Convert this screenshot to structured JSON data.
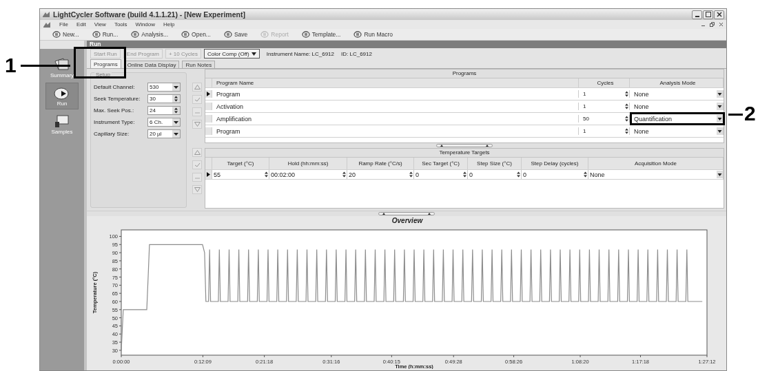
{
  "window": {
    "title": "LightCycler Software (build 4.1.1.21) - [New Experiment]"
  },
  "menu": [
    "File",
    "Edit",
    "View",
    "Tools",
    "Window",
    "Help"
  ],
  "toolbar": [
    {
      "label": "New...",
      "disabled": false
    },
    {
      "label": "Run...",
      "disabled": false
    },
    {
      "label": "Analysis...",
      "disabled": false
    },
    {
      "label": "Open...",
      "disabled": false
    },
    {
      "label": "Save",
      "disabled": false
    },
    {
      "label": "Report",
      "disabled": true
    },
    {
      "label": "Template...",
      "disabled": false
    },
    {
      "label": "Run Macro",
      "disabled": false
    }
  ],
  "sidebar": {
    "items": [
      {
        "label": "Summary",
        "selected": false
      },
      {
        "label": "Run",
        "selected": true
      },
      {
        "label": "Samples",
        "selected": false
      }
    ]
  },
  "run_panel": {
    "title": "Run",
    "buttons": [
      {
        "label": "Start Run",
        "disabled": true
      },
      {
        "label": "End Program",
        "disabled": true
      },
      {
        "label": "+ 10 Cycles",
        "disabled": true
      }
    ],
    "color_comp": "Color Comp (Off)",
    "instrument_name": "Instrument Name: LC_6912",
    "instrument_id": "ID: LC_6912"
  },
  "tabs": [
    {
      "label": "Programs",
      "selected": true
    },
    {
      "label": "Online Data Display",
      "selected": false
    },
    {
      "label": "Run Notes",
      "selected": false
    }
  ],
  "setup": {
    "title": "Setup",
    "fields": [
      {
        "label": "Default Channel:",
        "value": "530",
        "kind": "dropdown"
      },
      {
        "label": "Seek Temperature:",
        "value": "30",
        "kind": "spinner"
      },
      {
        "label": "Max. Seek Pos.:",
        "value": "24",
        "kind": "spinner"
      },
      {
        "label": "Instrument Type:",
        "value": "6 Ch.",
        "kind": "dropdown"
      },
      {
        "label": "Capillary Size:",
        "value": "20 µl",
        "kind": "dropdown"
      }
    ]
  },
  "programs": {
    "title": "Programs",
    "columns": [
      "Program Name",
      "Cycles",
      "Analysis Mode"
    ],
    "rows": [
      {
        "name": "Program",
        "cycles": "1",
        "analysis_mode": "None",
        "selected": true
      },
      {
        "name": "Activation",
        "cycles": "1",
        "analysis_mode": "None",
        "selected": false
      },
      {
        "name": "Amplification",
        "cycles": "50",
        "analysis_mode": "Quantification",
        "selected": false
      },
      {
        "name": "Program",
        "cycles": "1",
        "analysis_mode": "None",
        "selected": false
      }
    ]
  },
  "temperature_targets": {
    "title": "Temperature Targets",
    "columns": [
      "Target (°C)",
      "Hold (hh:mm:ss)",
      "Ramp Rate (°C/s)",
      "Sec Target (°C)",
      "Step Size (°C)",
      "Step Delay (cycles)",
      "Acquisition Mode"
    ],
    "rows": [
      {
        "cells": [
          "55",
          "00:02:00",
          "20",
          "0",
          "0",
          "0",
          "None"
        ],
        "selected": true
      }
    ]
  },
  "overview": {
    "chart_data": {
      "type": "line",
      "title": "Overview",
      "xlabel": "Time (h:mm:ss)",
      "ylabel": "Temperature (°C)",
      "xlim": [
        0,
        87.2
      ],
      "ylim": [
        27,
        104
      ],
      "yticks": [
        30,
        35,
        40,
        45,
        50,
        55,
        60,
        65,
        70,
        75,
        80,
        85,
        90,
        95,
        100
      ],
      "xticks": [
        {
          "value": 0,
          "label": "0:00:00"
        },
        {
          "value": 12.15,
          "label": "0:12:09"
        },
        {
          "value": 21.3,
          "label": "0:21:18"
        },
        {
          "value": 31.27,
          "label": "0:31:16"
        },
        {
          "value": 40.25,
          "label": "0:40:15"
        },
        {
          "value": 49.47,
          "label": "0:49:28"
        },
        {
          "value": 58.43,
          "label": "0:58:26"
        },
        {
          "value": 68.33,
          "label": "1:08:20"
        },
        {
          "value": 77.3,
          "label": "1:17:18"
        },
        {
          "value": 87.2,
          "label": "1:27:12"
        }
      ],
      "x": [
        0,
        0.3,
        3.8,
        4.0,
        4.2,
        12.1,
        12.4,
        12.6,
        13,
        13.15,
        13.3,
        14.45,
        14.6,
        14.75,
        15.9,
        16.05,
        16.2,
        17.35,
        17.5,
        17.65,
        18.8,
        18.95,
        19.1,
        20.25,
        20.4,
        20.55,
        21.7,
        21.85,
        22,
        23.15,
        23.3,
        23.45,
        24.6,
        24.75,
        24.9,
        26.05,
        26.2,
        26.35,
        27.5,
        27.65,
        27.8,
        28.95,
        29.1,
        29.25,
        30.4,
        30.55,
        30.7,
        31.85,
        32,
        32.15,
        33.3,
        33.45,
        33.6,
        34.75,
        34.9,
        35.05,
        36.2,
        36.35,
        36.5,
        37.65,
        37.8,
        37.95,
        39.1,
        39.25,
        39.4,
        40.55,
        40.7,
        40.85,
        42,
        42.15,
        42.3,
        43.45,
        43.6,
        43.75,
        44.9,
        45.05,
        45.2,
        46.35,
        46.5,
        46.65,
        47.8,
        47.95,
        48.1,
        49.25,
        49.4,
        49.55,
        50.7,
        50.85,
        51,
        52.15,
        52.3,
        52.45,
        53.6,
        53.75,
        53.9,
        55.05,
        55.2,
        55.35,
        56.5,
        56.65,
        56.8,
        57.95,
        58.1,
        58.25,
        59.4,
        59.55,
        59.7,
        60.85,
        61,
        61.15,
        62.3,
        62.45,
        62.6,
        63.75,
        63.9,
        64.05,
        65.2,
        65.35,
        65.5,
        66.65,
        66.8,
        66.95,
        68.1,
        68.25,
        68.4,
        69.55,
        69.7,
        69.85,
        71,
        71.15,
        71.3,
        72.45,
        72.6,
        72.75,
        73.9,
        74.05,
        74.2,
        75.35,
        75.5,
        75.65,
        76.8,
        76.95,
        77.1,
        78.25,
        78.4,
        78.55,
        79.7,
        79.85,
        80,
        81.15,
        81.3,
        81.45,
        82.6,
        82.75,
        82.9,
        84.05,
        84.2,
        84.35,
        86.5
      ],
      "series": [
        {
          "color": "#8c8c8c",
          "values": [
            30,
            55,
            55,
            75,
            95,
            95,
            90,
            60,
            60,
            92,
            60,
            60,
            92,
            60,
            60,
            92,
            60,
            60,
            92,
            60,
            60,
            92,
            60,
            60,
            92,
            60,
            60,
            92,
            60,
            60,
            92,
            60,
            60,
            92,
            60,
            60,
            92,
            60,
            60,
            92,
            60,
            60,
            92,
            60,
            60,
            92,
            60,
            60,
            92,
            60,
            60,
            92,
            60,
            60,
            92,
            60,
            60,
            92,
            60,
            60,
            92,
            60,
            60,
            92,
            60,
            60,
            92,
            60,
            60,
            92,
            60,
            60,
            92,
            60,
            60,
            92,
            60,
            60,
            92,
            60,
            60,
            92,
            60,
            60,
            92,
            60,
            60,
            92,
            60,
            60,
            92,
            60,
            60,
            92,
            60,
            60,
            92,
            60,
            60,
            92,
            60,
            60,
            92,
            60,
            60,
            92,
            60,
            60,
            92,
            60,
            60,
            92,
            60,
            60,
            92,
            60,
            60,
            92,
            60,
            60,
            92,
            60,
            60,
            92,
            60,
            60,
            92,
            60,
            60,
            92,
            60,
            60,
            92,
            60,
            60,
            92,
            60,
            60,
            92,
            60,
            60,
            92,
            60,
            60,
            92,
            60,
            60,
            92,
            60,
            60,
            92,
            60,
            60,
            92,
            60,
            60,
            92,
            60,
            60
          ]
        }
      ]
    }
  },
  "callouts": [
    {
      "label": "1"
    },
    {
      "label": "2"
    }
  ]
}
